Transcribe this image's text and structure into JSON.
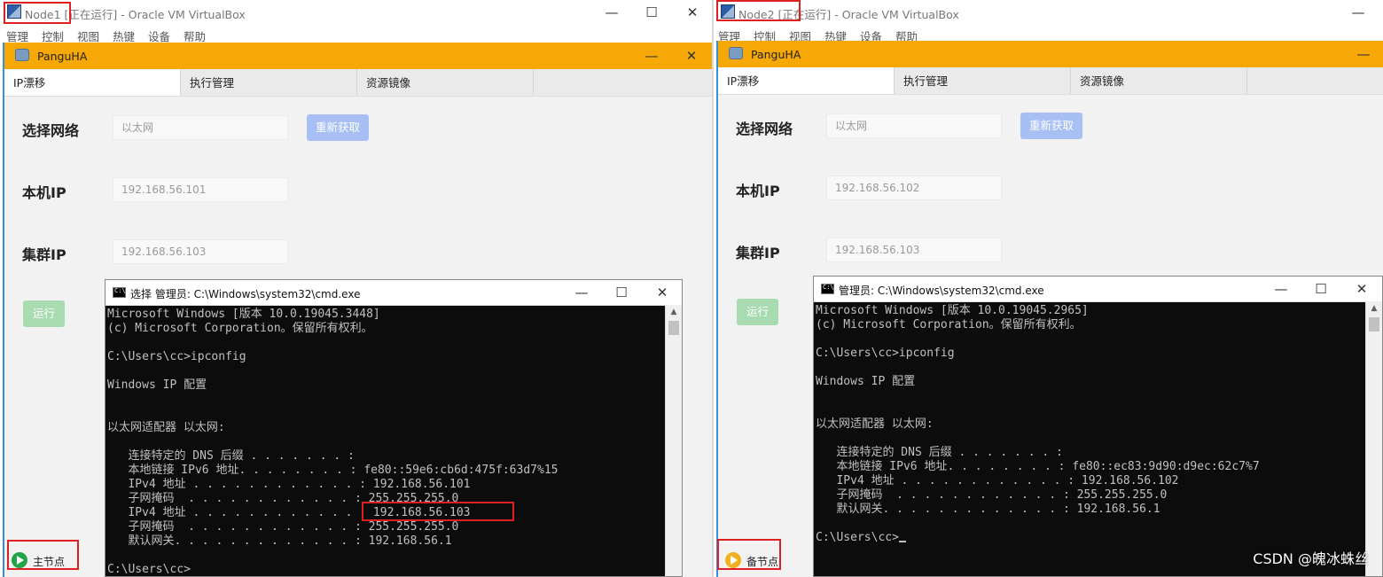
{
  "menu_items": [
    "管理",
    "控制",
    "视图",
    "热键",
    "设备",
    "帮助"
  ],
  "window_controls": {
    "minimize": "—",
    "maximize": "☐",
    "close": "✕"
  },
  "app": {
    "name": "PanguHA",
    "tabs": [
      "IP漂移",
      "执行管理",
      "资源镜像"
    ],
    "labels": {
      "network": "选择网络",
      "local_ip": "本机IP",
      "cluster_ip": "集群IP"
    },
    "refresh_button": "重新获取",
    "run_button": "运行"
  },
  "node1": {
    "vbox_title": "Node1 [正在运行] - Oracle VM VirtualBox",
    "network_value": "以太网",
    "local_ip": "192.168.56.101",
    "cluster_ip": "192.168.56.103",
    "status_label": "主节点",
    "status_color": "#21a347",
    "cmd_title": "选择 管理员: C:\\Windows\\system32\\cmd.exe",
    "cmd_lines": [
      "Microsoft Windows [版本 10.0.19045.3448]",
      "(c) Microsoft Corporation。保留所有权利。",
      "",
      "C:\\Users\\cc>ipconfig",
      "",
      "Windows IP 配置",
      "",
      "",
      "以太网适配器 以太网:",
      "",
      "   连接特定的 DNS 后缀 . . . . . . . :",
      "   本地链接 IPv6 地址. . . . . . . . : fe80::59e6:cb6d:475f:63d7%15",
      "   IPv4 地址 . . . . . . . . . . . . : 192.168.56.101",
      "   子网掩码  . . . . . . . . . . . . : 255.255.255.0",
      "   IPv4 地址 . . . . . . . . . . . . : 192.168.56.103",
      "   子网掩码  . . . . . . . . . . . . : 255.255.255.0",
      "   默认网关. . . . . . . . . . . . . : 192.168.56.1",
      "",
      "C:\\Users\\cc>"
    ]
  },
  "node2": {
    "vbox_title": "Node2 [正在运行] - Oracle VM VirtualBox",
    "network_value": "以太网",
    "local_ip": "192.168.56.102",
    "cluster_ip": "192.168.56.103",
    "status_label": "备节点",
    "status_color": "#f2b01e",
    "cmd_title": "管理员: C:\\Windows\\system32\\cmd.exe",
    "cmd_lines": [
      "Microsoft Windows [版本 10.0.19045.2965]",
      "(c) Microsoft Corporation。保留所有权利。",
      "",
      "C:\\Users\\cc>ipconfig",
      "",
      "Windows IP 配置",
      "",
      "",
      "以太网适配器 以太网:",
      "",
      "   连接特定的 DNS 后缀 . . . . . . . :",
      "   本地链接 IPv6 地址. . . . . . . . : fe80::ec83:9d90:d9ec:62c7%7",
      "   IPv4 地址 . . . . . . . . . . . . : 192.168.56.102",
      "   子网掩码  . . . . . . . . . . . . : 255.255.255.0",
      "   默认网关. . . . . . . . . . . . . : 192.168.56.1",
      "",
      "C:\\Users\\cc>"
    ]
  },
  "watermark": "CSDN @魄冰蛛丝",
  "highlight_color": "#e02020"
}
